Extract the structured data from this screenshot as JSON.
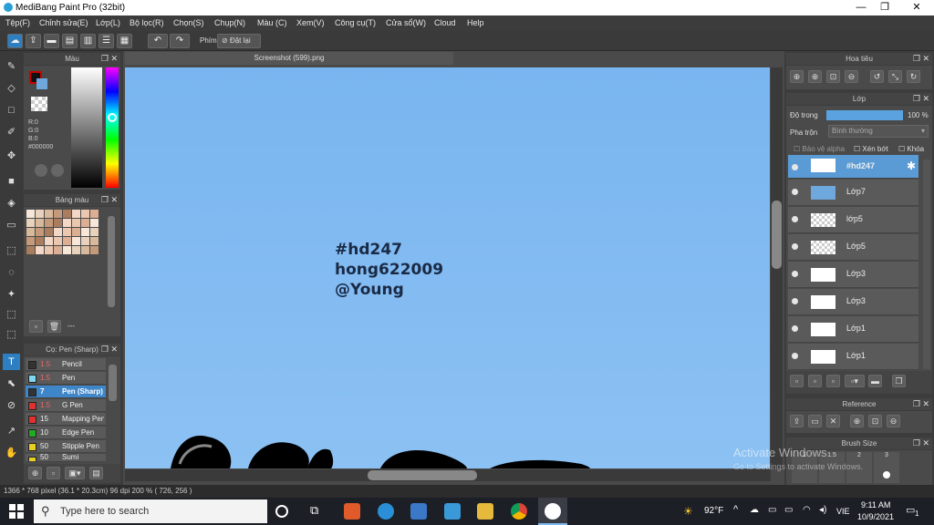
{
  "window": {
    "title": "MediBang Paint Pro (32bit)",
    "min": "—",
    "max": "❐",
    "close": "✕"
  },
  "menu": [
    "Tệp(F)",
    "Chỉnh sửa(E)",
    "Lớp(L)",
    "Bộ lọc(R)",
    "Chọn(S)",
    "Chụp(N)",
    "Màu (C)",
    "Xem(V)",
    "Công cụ(T)",
    "Cửa sổ(W)",
    "Cloud",
    "Help"
  ],
  "toolbar": {
    "phim_label": "Phím",
    "reset_label": "Đặt lại"
  },
  "color_panel": {
    "title": "Màu",
    "r": "R:0",
    "g": "G:0",
    "b": "B:0",
    "hex": "#000000",
    "primary": "#cc0000",
    "secondary": "#6fa8dc"
  },
  "palette_panel": {
    "title": "Bảng màu",
    "footer": "---"
  },
  "brush_panel": {
    "title": "Cọ: Pen (Sharp)",
    "brushes": [
      {
        "size": "1.5",
        "name": "Pencil",
        "color": "#333333"
      },
      {
        "size": "1.5",
        "name": "Pen",
        "color": "#7fd6f0"
      },
      {
        "size": "7",
        "name": "Pen (Sharp)",
        "color": "#333333"
      },
      {
        "size": "1.5",
        "name": "G Pen",
        "color": "#e03030"
      },
      {
        "size": "15",
        "name": "Mapping Pen",
        "color": "#e03030"
      },
      {
        "size": "10",
        "name": "Edge Pen",
        "color": "#22aa22"
      },
      {
        "size": "50",
        "name": "Stipple Pen",
        "color": "#e8d020"
      },
      {
        "size": "50",
        "name": "Sumi",
        "color": "#e8d020"
      }
    ]
  },
  "document": {
    "tab": "Screenshot (599).png",
    "lines": [
      "#hd247",
      "hong622009",
      "@Young"
    ]
  },
  "nav_panel": {
    "title": "Hoa tiêu"
  },
  "layer_panel": {
    "title": "Lớp",
    "opacity_label": "Độ trong",
    "opacity_value": "100 %",
    "blend_label": "Pha trộn",
    "blend_value": "Bình thường",
    "protect_alpha": "Bảo vệ alpha",
    "clipping": "Xén bớt",
    "lock": "Khóa",
    "layers": [
      "#hd247",
      "Lớp7",
      "lớp5",
      "Lớp5",
      "Lớp3",
      "Lớp3",
      "Lớp1",
      "Lớp1"
    ]
  },
  "reference_panel": {
    "title": "Reference"
  },
  "brush_size_panel": {
    "title": "Brush Size",
    "sizes": [
      "1",
      "1.5",
      "2",
      "3"
    ]
  },
  "watermark": {
    "line1": "Activate Windows",
    "line2": "Go to Settings to activate Windows."
  },
  "status": {
    "text": "1366 * 768 pixel   (36.1 * 20.3cm)   96 dpi   200 %   ( 726, 256 )"
  },
  "taskbar": {
    "search_placeholder": "Type here to search",
    "weather": "92°F",
    "lang": "VIE",
    "time": "9:11 AM",
    "date": "10/9/2021",
    "notif": "1"
  }
}
